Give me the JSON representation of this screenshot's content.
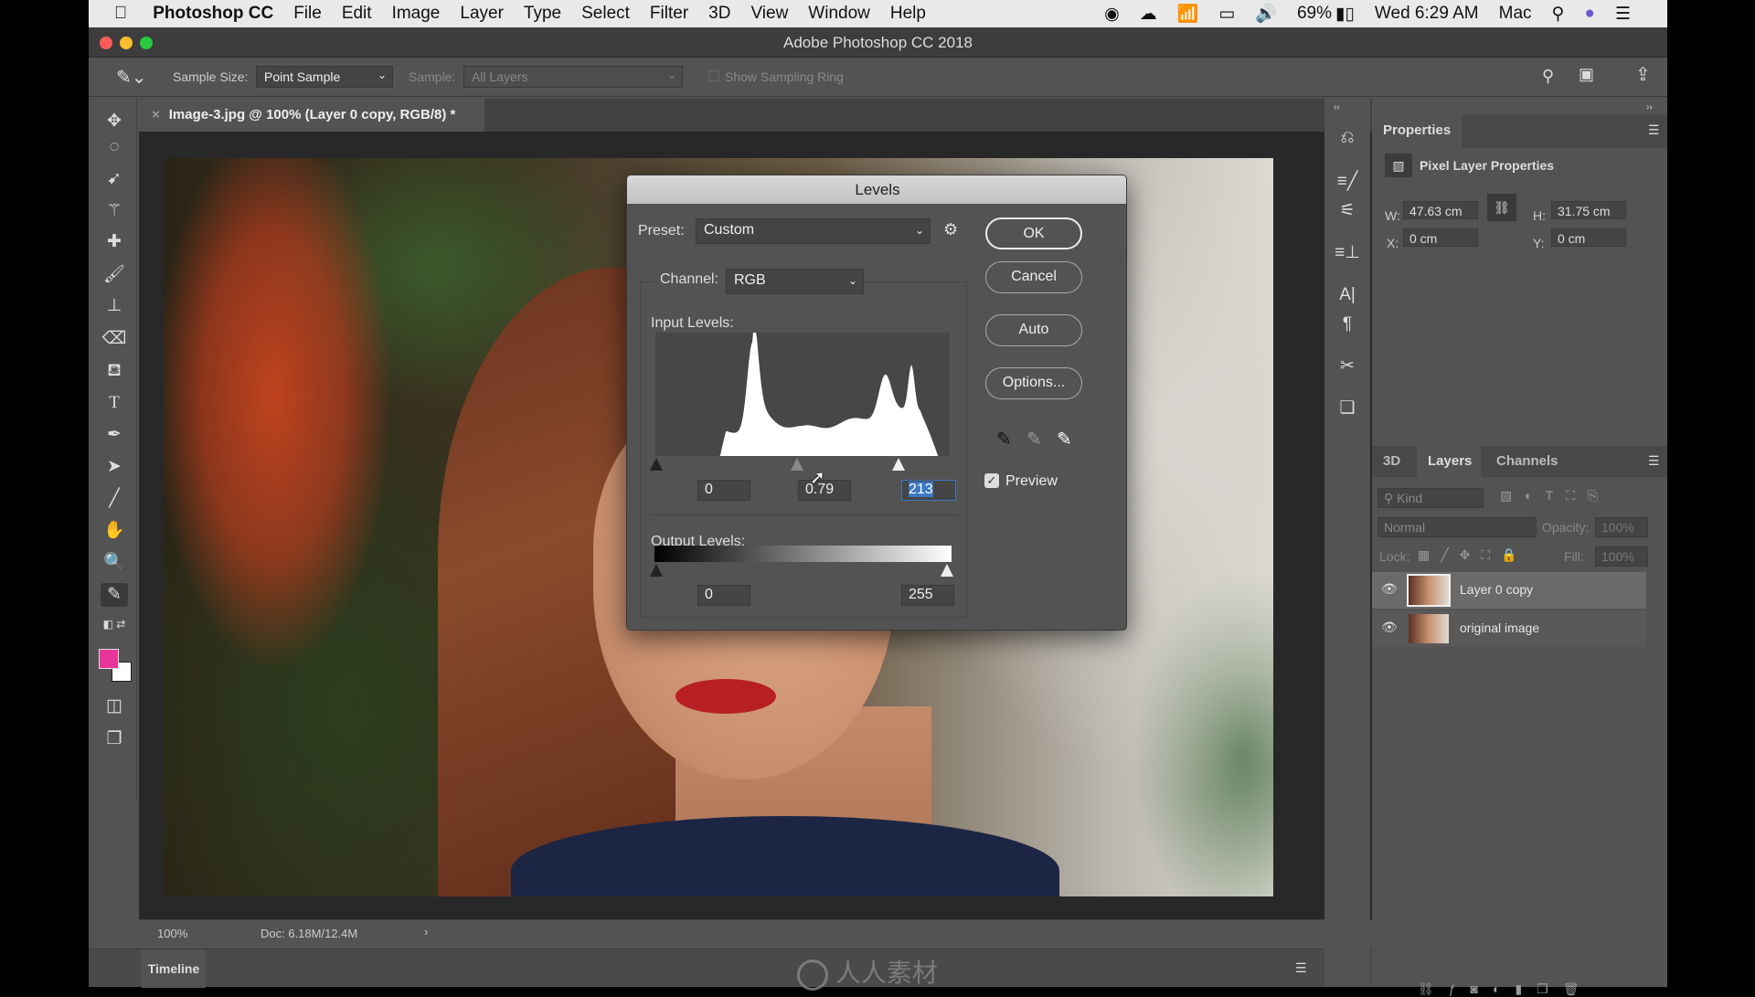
{
  "menubar": {
    "app": "Photoshop CC",
    "items": [
      "File",
      "Edit",
      "Image",
      "Layer",
      "Type",
      "Select",
      "Filter",
      "3D",
      "View",
      "Window",
      "Help"
    ],
    "battery": "69%",
    "clock": "Wed 6:29 AM",
    "user": "Mac"
  },
  "window": {
    "title": "Adobe Photoshop CC 2018"
  },
  "options": {
    "sample_size_label": "Sample Size:",
    "sample_size": "Point Sample",
    "sample_label": "Sample:",
    "sample": "All Layers",
    "ring_label": "Show Sampling Ring"
  },
  "document": {
    "tab": "Image-3.jpg @ 100% (Layer 0 copy, RGB/8) *",
    "zoom": "100%",
    "doc_size": "Doc: 6.18M/12.4M"
  },
  "timeline": {
    "label": "Timeline"
  },
  "watermark": "人人素材",
  "colors": {
    "foreground": "#e8359a",
    "background": "#ffffff"
  },
  "properties": {
    "title": "Properties",
    "subtitle": "Pixel Layer Properties",
    "w_label": "W:",
    "w": "47.63 cm",
    "h_label": "H:",
    "h": "31.75 cm",
    "x_label": "X:",
    "x": "0 cm",
    "y_label": "Y:",
    "y": "0 cm"
  },
  "layers_panel": {
    "tabs": [
      "3D",
      "Layers",
      "Channels"
    ],
    "active_tab": "Layers",
    "kind": "Kind",
    "blend": "Normal",
    "opacity_label": "Opacity:",
    "opacity": "100%",
    "lock_label": "Lock:",
    "fill_label": "Fill:",
    "fill": "100%",
    "layers": [
      {
        "name": "Layer 0 copy",
        "visible": true,
        "selected": true
      },
      {
        "name": "original image",
        "visible": true,
        "selected": false
      }
    ]
  },
  "levels": {
    "title": "Levels",
    "preset_label": "Preset:",
    "preset": "Custom",
    "channel_label": "Channel:",
    "channel": "RGB",
    "input_label": "Input Levels:",
    "input_black": "0",
    "input_gamma": "0.79",
    "input_white": "213",
    "output_label": "Output Levels:",
    "output_black": "0",
    "output_white": "255",
    "buttons": {
      "ok": "OK",
      "cancel": "Cancel",
      "auto": "Auto",
      "options": "Options..."
    },
    "preview_label": "Preview",
    "preview_checked": true
  }
}
